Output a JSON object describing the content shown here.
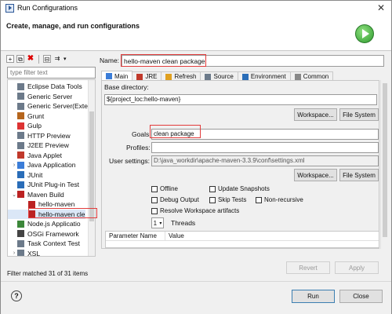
{
  "window": {
    "title": "Run Configurations",
    "close_glyph": "✕"
  },
  "header": {
    "title": "Create, manage, and run configurations",
    "icon": "run-icon"
  },
  "left": {
    "toolbar": [
      "new-config-icon",
      "duplicate-icon",
      "delete-icon",
      "collapse-icon",
      "filter-icon"
    ],
    "filter_placeholder": "type filter text",
    "tree": [
      {
        "label": "Eclipse Data Tools",
        "icon": "data-tools-icon",
        "color": "#6c7a8a"
      },
      {
        "label": "Generic Server",
        "icon": "server-icon",
        "color": "#6c7a8a"
      },
      {
        "label": "Generic Server(Exte",
        "icon": "server-icon",
        "color": "#6c7a8a"
      },
      {
        "label": "Grunt",
        "icon": "grunt-icon",
        "color": "#b5651d"
      },
      {
        "label": "Gulp",
        "icon": "gulp-icon",
        "color": "#d33"
      },
      {
        "label": "HTTP Preview",
        "icon": "http-icon",
        "color": "#6c7a8a"
      },
      {
        "label": "J2EE Preview",
        "icon": "j2ee-icon",
        "color": "#6c7a8a"
      },
      {
        "label": "Java Applet",
        "icon": "applet-icon",
        "color": "#c0392b"
      },
      {
        "label": "Java Application",
        "icon": "java-app-icon",
        "color": "#3b7dd8",
        "twisty": "›"
      },
      {
        "label": "JUnit",
        "icon": "junit-icon",
        "color": "#2a6db8"
      },
      {
        "label": "JUnit Plug-in Test",
        "icon": "junit-plugin-icon",
        "color": "#2a6db8"
      },
      {
        "label": "Maven Build",
        "icon": "maven-icon",
        "color": "#b22",
        "twisty": "⌄",
        "indent": 0
      },
      {
        "label": "hello-maven",
        "icon": "maven-icon",
        "color": "#b22",
        "indent": 1
      },
      {
        "label": "hello-maven cle",
        "icon": "maven-icon",
        "color": "#b22",
        "indent": 1,
        "selected": true
      },
      {
        "label": "Node.js Applicatio",
        "icon": "nodejs-icon",
        "color": "#3c873a"
      },
      {
        "label": "OSGi Framework",
        "icon": "osgi-icon",
        "color": "#444"
      },
      {
        "label": "Task Context Test",
        "icon": "task-icon",
        "color": "#6c7a8a"
      },
      {
        "label": "XSL",
        "icon": "xsl-icon",
        "color": "#6c7a8a",
        "twisty": "›"
      }
    ],
    "status": "Filter matched 31 of 31 items"
  },
  "right": {
    "name_label": "Name:",
    "name_value": "hello-maven clean package",
    "tabs": [
      {
        "label": "Main",
        "icon": "main-tab-icon",
        "color": "#3b7dd8",
        "active": true
      },
      {
        "label": "JRE",
        "icon": "jre-tab-icon",
        "color": "#c0392b"
      },
      {
        "label": "Refresh",
        "icon": "refresh-tab-icon",
        "color": "#e0a020"
      },
      {
        "label": "Source",
        "icon": "source-tab-icon",
        "color": "#6c7a8a"
      },
      {
        "label": "Environment",
        "icon": "environment-tab-icon",
        "color": "#2a6db8"
      },
      {
        "label": "Common",
        "icon": "common-tab-icon",
        "color": "#888"
      }
    ],
    "base_dir_label": "Base directory:",
    "base_dir_value": "${project_loc:hello-maven}",
    "workspace_btn": "Workspace...",
    "filesystem_btn": "File System",
    "goals_label": "Goals:",
    "goals_value": "clean package",
    "profiles_label": "Profiles:",
    "profiles_value": "",
    "user_settings_label": "User settings:",
    "user_settings_value": "D:\\java_workdir\\apache-maven-3.3.9\\conf\\settings.xml",
    "checkboxes": {
      "offline": "Offline",
      "update_snapshots": "Update Snapshots",
      "debug_output": "Debug Output",
      "skip_tests": "Skip Tests",
      "non_recursive": "Non-recursive",
      "resolve_workspace": "Resolve Workspace artifacts"
    },
    "threads_value": "1",
    "threads_label": "Threads",
    "param_headers": [
      "Parameter Name",
      "Value"
    ],
    "revert_btn": "Revert",
    "apply_btn": "Apply"
  },
  "footer": {
    "help_glyph": "?",
    "run_btn": "Run",
    "close_btn": "Close"
  }
}
